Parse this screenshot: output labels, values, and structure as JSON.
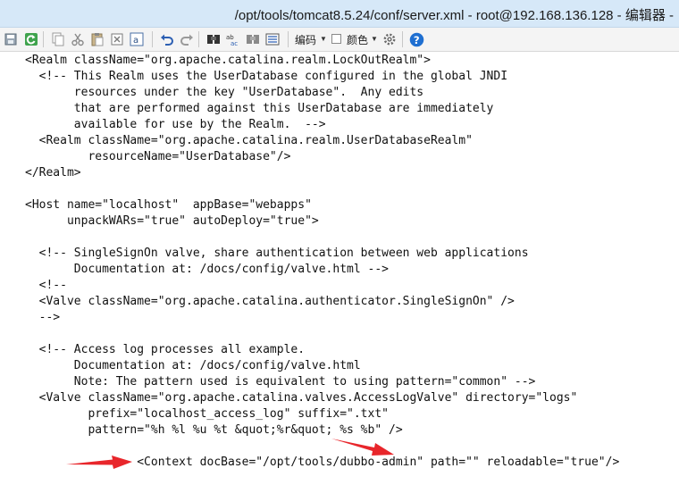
{
  "window": {
    "title": "/opt/tools/tomcat8.5.24/conf/server.xml - root@192.168.136.128 - 编辑器 -"
  },
  "toolbar": {
    "encoding_label": "编码",
    "color_label": "颜色",
    "icons": [
      "save-all-icon",
      "refresh-icon",
      "copy-icon",
      "cut-icon",
      "paste-icon",
      "close-file-icon",
      "text-format-icon",
      "undo-icon",
      "redo-icon",
      "find-icon",
      "replace-icon",
      "find-next-icon",
      "goto-line-icon",
      "settings-icon",
      "help-icon"
    ]
  },
  "editor": {
    "lines": [
      "<Realm className=\"org.apache.catalina.realm.LockOutRealm\">",
      "  <!-- This Realm uses the UserDatabase configured in the global JNDI",
      "       resources under the key \"UserDatabase\".  Any edits",
      "       that are performed against this UserDatabase are immediately",
      "       available for use by the Realm.  -->",
      "  <Realm className=\"org.apache.catalina.realm.UserDatabaseRealm\"",
      "         resourceName=\"UserDatabase\"/>",
      "</Realm>",
      "",
      "<Host name=\"localhost\"  appBase=\"webapps\"",
      "      unpackWARs=\"true\" autoDeploy=\"true\">",
      "",
      "  <!-- SingleSignOn valve, share authentication between web applications",
      "       Documentation at: /docs/config/valve.html -->",
      "  <!--",
      "  <Valve className=\"org.apache.catalina.authenticator.SingleSignOn\" />",
      "  -->",
      "",
      "  <!-- Access log processes all example.",
      "       Documentation at: /docs/config/valve.html",
      "       Note: The pattern used is equivalent to using pattern=\"common\" -->",
      "  <Valve className=\"org.apache.catalina.valves.AccessLogValve\" directory=\"logs\"",
      "         prefix=\"localhost_access_log\" suffix=\".txt\"",
      "         pattern=\"%h %l %u %t &quot;%r&quot; %s %b\" />",
      "",
      "                <Context docBase=\"/opt/tools/dubbo-admin\" path=\"\" reloadable=\"true\"/>"
    ]
  },
  "colors": {
    "titlebar": "#d6e8f8",
    "annotation_arrow": "#e8262b",
    "help_icon": "#1f6fd1"
  }
}
